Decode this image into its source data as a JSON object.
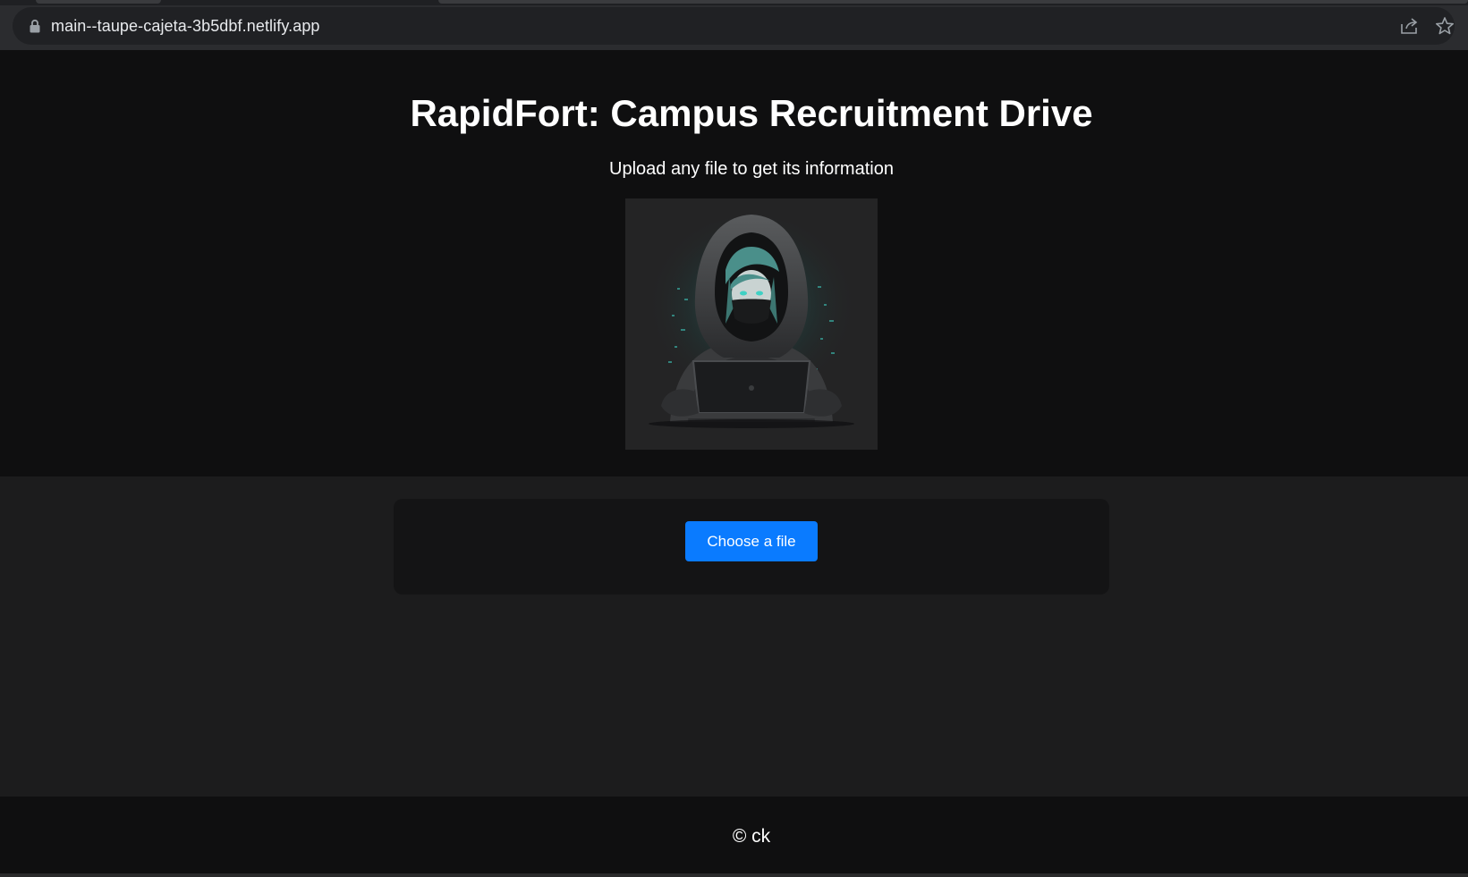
{
  "browser": {
    "url": "main--taupe-cajeta-3b5dbf.netlify.app",
    "icons": [
      "lock-icon",
      "share-icon",
      "star-icon"
    ]
  },
  "header": {
    "title": "RapidFort: Campus Recruitment Drive",
    "subtitle": "Upload any file to get its information",
    "image_subject": "hooded-hacker-illustration"
  },
  "upload": {
    "button_label": "Choose a file"
  },
  "footer": {
    "text": "© ck"
  },
  "colors": {
    "header_bg": "#0f0f10",
    "main_bg": "#1c1c1d",
    "card_bg": "#141415",
    "button": "#0a7bff",
    "accent_glow": "#3fd1c4"
  }
}
